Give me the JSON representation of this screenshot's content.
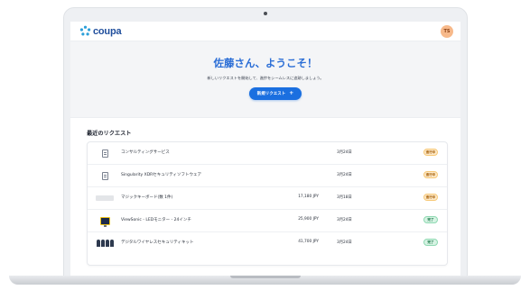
{
  "app": {
    "logo_text": "coupa",
    "avatar_initials": "TS",
    "brand_color": "#1f4e9c",
    "accent_color": "#1a6fe0"
  },
  "hero": {
    "greeting": "佐藤さん、ようこそ！",
    "subtitle": "新しいリクエストを開始して、進捗をシームレスに追跡しましょう。",
    "new_request_label": "新規リクエスト",
    "new_request_icon": "plus-icon"
  },
  "recent": {
    "title": "最近のリクエスト",
    "rows": [
      {
        "thumb": "document-icon",
        "name": "コンサルティングサービス",
        "price": "",
        "date": "3月24日",
        "status": "進行中",
        "status_type": "progress"
      },
      {
        "thumb": "document-icon",
        "name": "Singularity XDRセキュリティソフトウェア",
        "price": "",
        "date": "3月24日",
        "status": "進行中",
        "status_type": "progress"
      },
      {
        "thumb": "keyboard-image",
        "name": "マジックキーボード(数 1件)",
        "price": "17,180 JPY",
        "date": "3月18日",
        "status": "進行中",
        "status_type": "progress"
      },
      {
        "thumb": "monitor-image",
        "name": "ViewSonic - LEDモニター - 24インチ",
        "price": "25,900 JPY",
        "date": "3月24日",
        "status": "完了",
        "status_type": "done"
      },
      {
        "thumb": "security-kit-image",
        "name": "デジタルワイヤレスセキュリティキット",
        "price": "41,700 JPY",
        "date": "3月24日",
        "status": "完了",
        "status_type": "done"
      }
    ]
  },
  "status_colors": {
    "progress": "#a35b00",
    "done": "#1d7a4b"
  }
}
